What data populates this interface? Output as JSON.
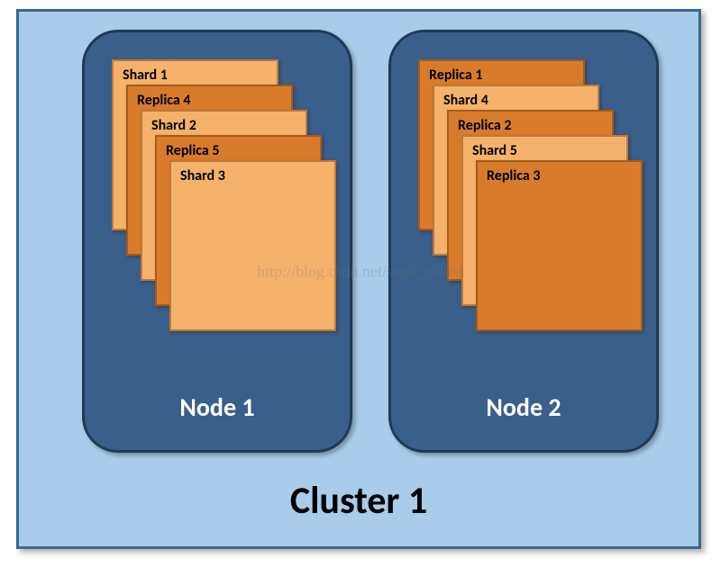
{
  "cluster": {
    "title": "Cluster 1",
    "nodes": [
      {
        "title": "Node 1",
        "cards": [
          {
            "label": "Shard 1",
            "type": "shard"
          },
          {
            "label": "Replica 4",
            "type": "replica"
          },
          {
            "label": "Shard 2",
            "type": "shard"
          },
          {
            "label": "Replica 5",
            "type": "replica"
          },
          {
            "label": "Shard 3",
            "type": "shard"
          }
        ]
      },
      {
        "title": "Node 2",
        "cards": [
          {
            "label": "Replica 1",
            "type": "replica"
          },
          {
            "label": "Shard 4",
            "type": "shard"
          },
          {
            "label": "Replica 2",
            "type": "replica"
          },
          {
            "label": "Shard 5",
            "type": "shard"
          },
          {
            "label": "Replica 3",
            "type": "replica"
          }
        ]
      }
    ]
  },
  "watermark": "http://blog.csdn.net/saga_gallon"
}
